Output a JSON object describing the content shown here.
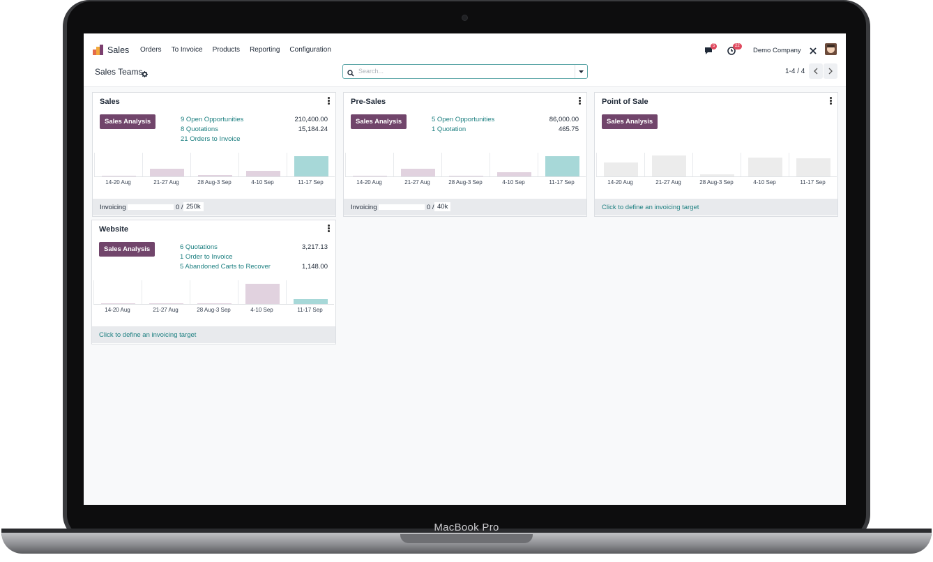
{
  "device": {
    "brand": "MacBook Pro"
  },
  "navbar": {
    "app_name": "Sales",
    "menu": [
      "Orders",
      "To Invoice",
      "Products",
      "Reporting",
      "Configuration"
    ],
    "messages_count": "5",
    "activities_count": "22",
    "company": "Demo Company",
    "icons": [
      "chat-icon",
      "clock-icon",
      "tools-icon",
      "avatar"
    ]
  },
  "control": {
    "breadcrumb": "Sales Teams",
    "search_placeholder": "Search...",
    "pager": "1-4 / 4"
  },
  "colors": {
    "accent": "#71456b",
    "link": "#1c7f80",
    "teal_bar": "#a7d8d8",
    "mauve_bar": "#e1d2df",
    "gray_bar": "#ececec"
  },
  "weeks": [
    "14-20 Aug",
    "21-27 Aug",
    "28 Aug-3 Sep",
    "4-10 Sep",
    "11-17 Sep"
  ],
  "cards": [
    {
      "title": "Sales",
      "button": "Sales Analysis",
      "stats": [
        {
          "label": "9 Open Opportunities",
          "value": "210,400.00"
        },
        {
          "label": "8 Quotations",
          "value": "15,184.24"
        },
        {
          "label": "21 Orders to Invoice",
          "value": ""
        }
      ],
      "bars": [
        0.02,
        0.35,
        0.05,
        0.25,
        0.97
      ],
      "bar_colors": [
        "mauve",
        "mauve",
        "mauve",
        "mauve",
        "teal"
      ],
      "footer": {
        "label": "Invoicing",
        "progress": "0 /",
        "target": "250k"
      }
    },
    {
      "title": "Pre-Sales",
      "button": "Sales Analysis",
      "stats": [
        {
          "label": "5 Open Opportunities",
          "value": "86,000.00"
        },
        {
          "label": "1 Quotation",
          "value": "465.75"
        }
      ],
      "bars": [
        0.0,
        0.35,
        0.0,
        0.2,
        0.97
      ],
      "bar_colors": [
        "mauve",
        "mauve",
        "mauve",
        "mauve",
        "teal"
      ],
      "footer": {
        "label": "Invoicing",
        "progress": "0 /",
        "target": "40k"
      }
    },
    {
      "title": "Point of Sale",
      "button": "Sales Analysis",
      "stats": [],
      "bars": [
        0.65,
        1.0,
        0.1,
        0.9,
        0.85
      ],
      "bar_colors": [
        "gray",
        "gray",
        "gray",
        "gray",
        "gray"
      ],
      "footer": {
        "link": "Click to define an invoicing target"
      }
    },
    {
      "title": "Website",
      "button": "Sales Analysis",
      "stats": [
        {
          "label": "6 Quotations",
          "value": "3,217.13"
        },
        {
          "label": "1 Order to Invoice",
          "value": ""
        },
        {
          "label": "5  Abandoned Carts to Recover",
          "value": "1,148.00"
        }
      ],
      "bars": [
        0.0,
        0.0,
        0.0,
        0.97,
        0.22
      ],
      "bar_colors": [
        "mauve",
        "mauve",
        "mauve",
        "mauve",
        "teal"
      ],
      "footer": {
        "link": "Click to define an invoicing target"
      }
    }
  ]
}
